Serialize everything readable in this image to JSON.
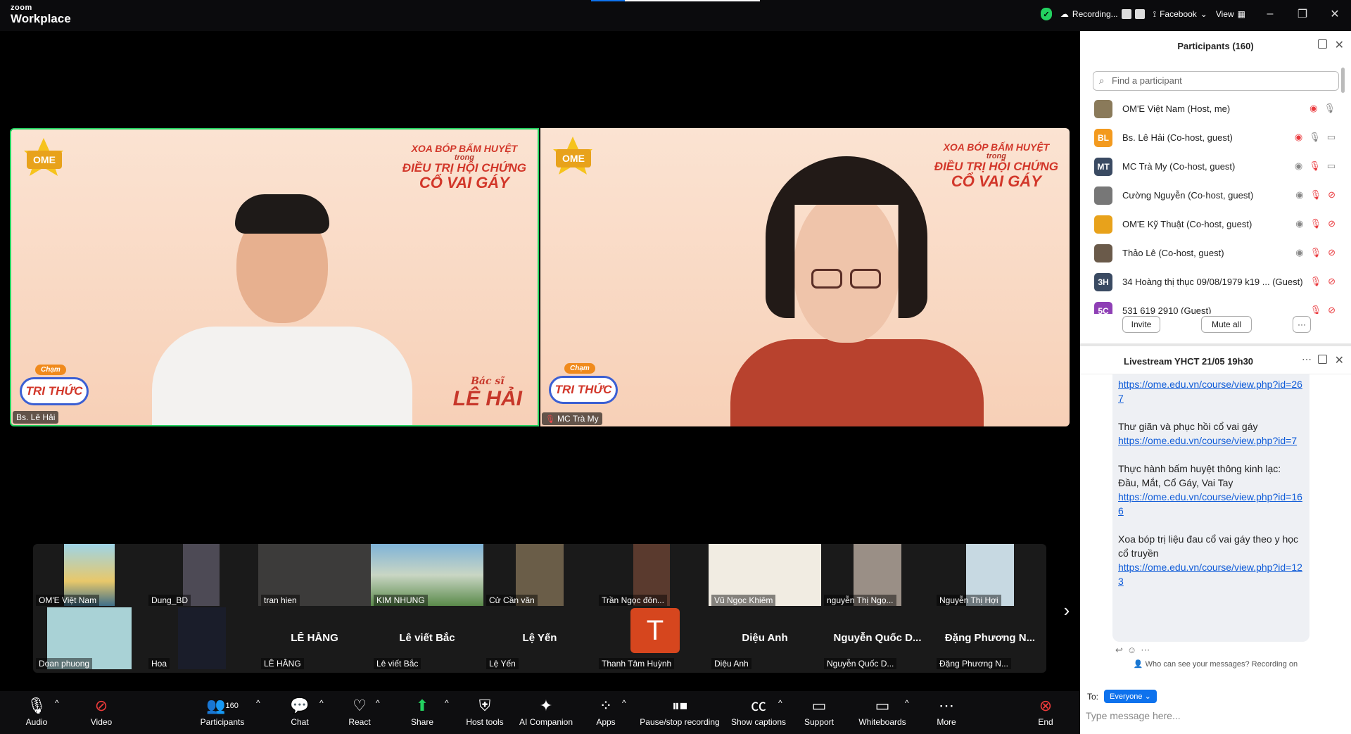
{
  "app": {
    "brand_top": "zoom",
    "brand_bottom": "Workplace"
  },
  "topbar": {
    "recording_label": "Recording...",
    "stream_label": "Facebook",
    "view_label": "View"
  },
  "speakers": [
    {
      "banner": [
        "XOA BÓP BẤM HUYỆT",
        "trong",
        "ĐIỀU TRỊ HỘI CHỨNG",
        "CỔ VAI GÁY"
      ],
      "logo_text": "OME",
      "cham": "Chạm",
      "trithuc": "TRI THỨC",
      "sign_small": "Bác sĩ",
      "sign_big": "LÊ HẢI",
      "name": "Bs. Lê Hải"
    },
    {
      "banner": [
        "XOA BÓP BẤM HUYỆT",
        "trong",
        "ĐIỀU TRỊ HỘI CHỨNG",
        "CỔ VAI GÁY"
      ],
      "logo_text": "OME",
      "cham": "Chạm",
      "trithuc": "TRI THỨC",
      "name": "MC Trà My"
    }
  ],
  "gallery": [
    {
      "name": "OM'E Việt Nam",
      "big": ""
    },
    {
      "name": "Dung_BD",
      "big": ""
    },
    {
      "name": "tran hien",
      "big": ""
    },
    {
      "name": "KIM NHUNG",
      "big": ""
    },
    {
      "name": "Cử Cần văn",
      "big": ""
    },
    {
      "name": "Trần Ngọc đôn...",
      "big": ""
    },
    {
      "name": "Vũ Ngọc Khiêm",
      "big": ""
    },
    {
      "name": "nguyễn Thị Ngọ...",
      "big": ""
    },
    {
      "name": "Nguyễn Thị Hợi",
      "big": ""
    },
    {
      "name": "Doan phuong",
      "big": ""
    },
    {
      "name": "Hoa",
      "big": ""
    },
    {
      "name": "LÊ HẰNG",
      "big": "LÊ HẰNG"
    },
    {
      "name": "Lê viết Bắc",
      "big": "Lê viết Bắc"
    },
    {
      "name": "Lệ Yến",
      "big": "Lệ Yến"
    },
    {
      "name": "Thanh Tâm Huỳnh",
      "big": "",
      "avatar": "T"
    },
    {
      "name": "Diệu Anh",
      "big": "Diệu Anh"
    },
    {
      "name": "Nguyễn Quốc D...",
      "big": "Nguyễn Quốc D..."
    },
    {
      "name": "Đặng Phương N...",
      "big": "Đặng Phương N..."
    }
  ],
  "toolbar": {
    "audio": "Audio",
    "video": "Video",
    "participants": "Participants",
    "participants_count": "160",
    "chat": "Chat",
    "react": "React",
    "share": "Share",
    "host_tools": "Host tools",
    "ai_companion": "AI Companion",
    "apps": "Apps",
    "pause_recording": "Pause/stop recording",
    "captions": "Show captions",
    "support": "Support",
    "whiteboards": "Whiteboards",
    "more": "More",
    "end": "End"
  },
  "participants_panel": {
    "title": "Participants (160)",
    "search_placeholder": "Find a participant",
    "rows": [
      {
        "initials": "",
        "name": "OM'E Việt Nam (Host, me)",
        "color": "#8a7a5a"
      },
      {
        "initials": "BL",
        "name": "Bs. Lê Hải (Co-host, guest)",
        "color": "#f39a1e"
      },
      {
        "initials": "MT",
        "name": "MC Trà My (Co-host, guest)",
        "color": "#3a4a62"
      },
      {
        "initials": "",
        "name": "Cường Nguyễn (Co-host, guest)",
        "color": "#777777"
      },
      {
        "initials": "",
        "name": "OM'E Kỹ Thuật (Co-host, guest)",
        "color": "#e8a21b"
      },
      {
        "initials": "",
        "name": "Thảo Lê (Co-host, guest)",
        "color": "#6a5a4a"
      },
      {
        "initials": "3H",
        "name": "34 Hoàng thị thục 09/08/1979 k19 ... (Guest)",
        "color": "#3a4a62"
      },
      {
        "initials": "5C",
        "name": "531 619 2910 (Guest)",
        "color": "#8e3fb5"
      }
    ],
    "invite": "Invite",
    "mute_all": "Mute all",
    "more": "···"
  },
  "chat_panel": {
    "title": "Livestream YHCT 21/05 19h30",
    "messages": [
      {
        "text": "",
        "link": "https://ome.edu.vn/course/view.php?id=267"
      },
      {
        "text": "Thư giãn và phục hồi cổ vai gáy",
        "link": "https://ome.edu.vn/course/view.php?id=7"
      },
      {
        "text": "Thực hành bấm huyệt thông kinh lạc: Đầu, Mắt, Cổ Gáy, Vai Tay",
        "link": "https://ome.edu.vn/course/view.php?id=166"
      },
      {
        "text": "Xoa bóp trị liệu đau cổ vai gáy theo y học cổ truyền",
        "link": "https://ome.edu.vn/course/view.php?id=123"
      }
    ],
    "who_can_see": "Who can see your messages? Recording on",
    "to_label": "To:",
    "to_value": "Everyone",
    "input_placeholder": "Type message here..."
  }
}
